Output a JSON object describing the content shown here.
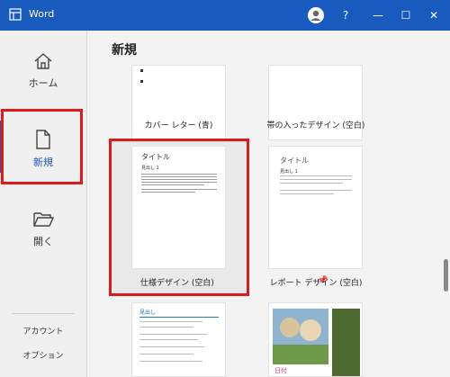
{
  "titlebar": {
    "app_name": "Word",
    "help": "?",
    "minimize": "—",
    "maximize": "☐",
    "close": "✕"
  },
  "sidebar": {
    "items": [
      {
        "label": "ホーム",
        "icon": "home-icon"
      },
      {
        "label": "新規",
        "icon": "new-document-icon",
        "selected": true
      },
      {
        "label": "開く",
        "icon": "open-folder-icon"
      }
    ],
    "account": "アカウント",
    "options": "オプション"
  },
  "main": {
    "heading": "新規",
    "templates": [
      {
        "label": "カバー レター (青)"
      },
      {
        "label": "帯の入ったデザイン (空白)"
      },
      {
        "label": "仕様デザイン (空白)",
        "preview_title": "タイトル",
        "preview_heading": "見出し 1",
        "pinned": true,
        "highlighted": true
      },
      {
        "label": "レポート デザイン (空白)",
        "preview_title": "タイトル",
        "preview_heading": "見出し 1"
      },
      {
        "label": "",
        "preview_heading": "見出し",
        "preview_accent": "#1a7ab4"
      },
      {
        "label": "",
        "preview_title": "日付",
        "preview_accent": "#4e6b2f"
      }
    ]
  },
  "colors": {
    "accent": "#185abd",
    "highlight": "#e11919"
  }
}
